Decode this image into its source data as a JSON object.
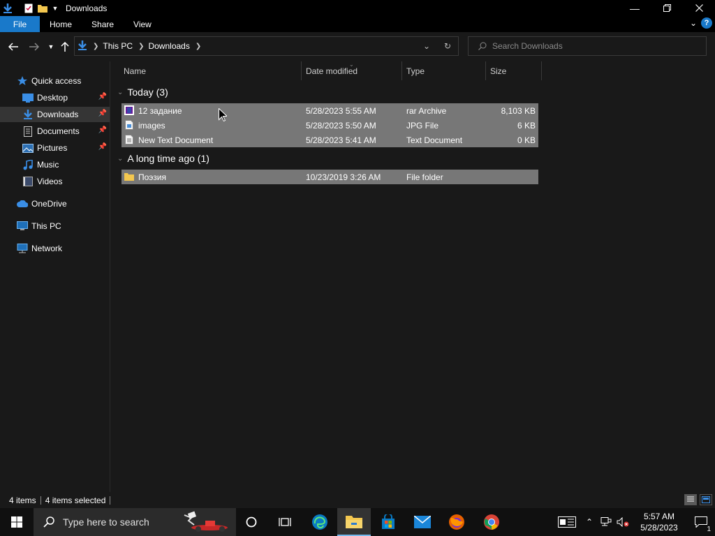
{
  "window": {
    "title": "Downloads"
  },
  "ribbon": {
    "tabs": [
      "File",
      "Home",
      "Share",
      "View"
    ]
  },
  "nav": {
    "breadcrumb": [
      "This PC",
      "Downloads"
    ],
    "search_placeholder": "Search Downloads"
  },
  "sidebar": {
    "items": [
      {
        "label": "Quick access",
        "icon": "star-icon"
      },
      {
        "label": "Desktop",
        "icon": "desktop-folder-icon",
        "pinned": true
      },
      {
        "label": "Downloads",
        "icon": "downloads-folder-icon",
        "pinned": true,
        "selected": true
      },
      {
        "label": "Documents",
        "icon": "documents-folder-icon",
        "pinned": true
      },
      {
        "label": "Pictures",
        "icon": "pictures-folder-icon",
        "pinned": true
      },
      {
        "label": "Music",
        "icon": "music-folder-icon"
      },
      {
        "label": "Videos",
        "icon": "videos-folder-icon"
      },
      {
        "label": "OneDrive",
        "icon": "cloud-icon"
      },
      {
        "label": "This PC",
        "icon": "computer-icon"
      },
      {
        "label": "Network",
        "icon": "network-icon"
      }
    ]
  },
  "columns": [
    "Name",
    "Date modified",
    "Type",
    "Size"
  ],
  "groups": [
    {
      "label": "Today (3)",
      "files": [
        {
          "name": "12 задание",
          "date": "5/28/2023 5:55 AM",
          "type": "rar Archive",
          "size": "8,103 KB",
          "icon": "rar-archive-icon"
        },
        {
          "name": "images",
          "date": "5/28/2023 5:50 AM",
          "type": "JPG File",
          "size": "6 KB",
          "icon": "jpg-file-icon"
        },
        {
          "name": "New Text Document",
          "date": "5/28/2023 5:41 AM",
          "type": "Text Document",
          "size": "0 KB",
          "icon": "text-file-icon"
        }
      ]
    },
    {
      "label": "A long time ago (1)",
      "files": [
        {
          "name": "Поэзия",
          "date": "10/23/2019 3:26 AM",
          "type": "File folder",
          "size": "",
          "icon": "folder-icon"
        }
      ]
    }
  ],
  "status": {
    "items": "4 items",
    "selected": "4 items selected"
  },
  "taskbar": {
    "search_placeholder": "Type here to search",
    "clock_time": "5:57 AM",
    "clock_date": "5/28/2023",
    "notification_count": "1"
  },
  "colors": {
    "accent": "#1979ca",
    "selection": "#777777",
    "background": "#191919"
  }
}
